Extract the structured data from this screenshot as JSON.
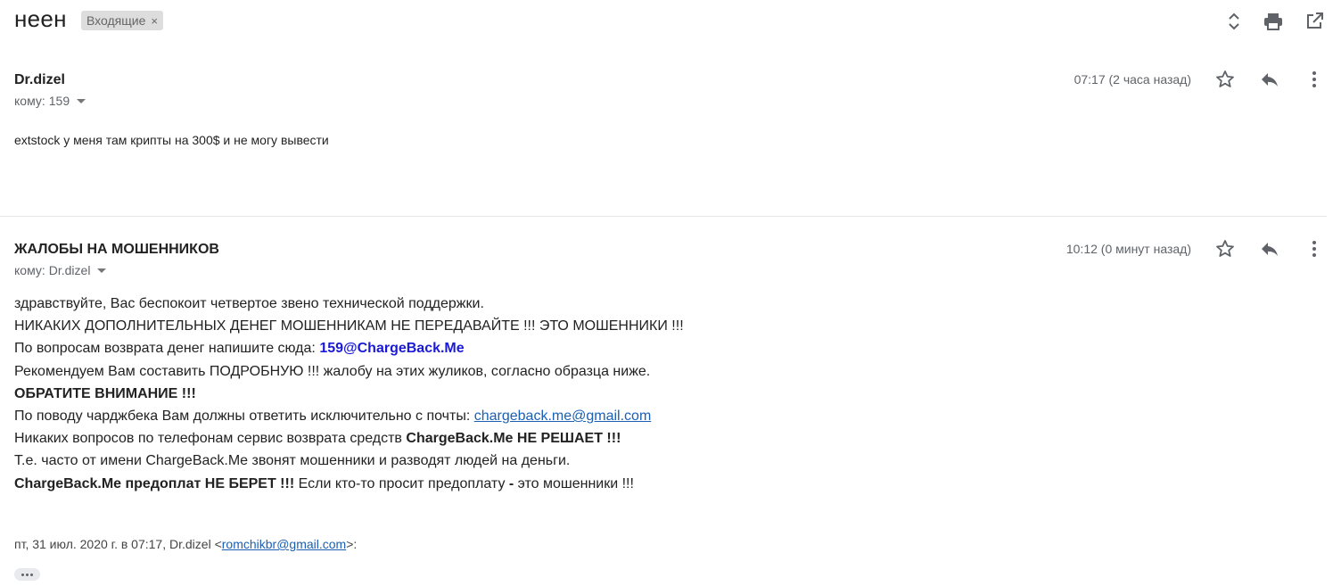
{
  "header": {
    "subject": "неен",
    "label": "Входящие",
    "label_remove": "×",
    "icons": [
      "expand-collapse-icon",
      "print-icon",
      "open-in-new-window-icon"
    ]
  },
  "messages": [
    {
      "sender": "Dr.dizel",
      "recipient_prefix": "кому:",
      "recipient": "159",
      "time": "07:17 (2 часа назад)",
      "body": "extstock у меня там крипты на 300$ и не могу вывести"
    },
    {
      "sender": "ЖАЛОБЫ НА МОШЕННИКОВ",
      "recipient_prefix": "кому:",
      "recipient": "Dr.dizel",
      "time": "10:12 (0 минут назад)",
      "body": {
        "l1": "здравствуйте, Вас беспокоит четвертое звено технической поддержки.",
        "l2": "НИКАКИХ ДОПОЛНИТЕЛЬНЫХ ДЕНЕГ МОШЕННИКАМ НЕ ПЕРЕДАВАЙТЕ !!! ЭТО МОШЕННИКИ !!!",
        "l3_text": "По вопросам возврата денег напишите сюда:",
        "l3_email": "159@ChargeBack.Me",
        "l4": "Рекомендуем Вам составить ПОДРОБНУЮ !!! жалобу на этих жуликов, согласно образца ниже.",
        "l5": "ОБРАТИТЕ ВНИМАНИЕ !!!",
        "l6_text": "По поводу чарджбека Вам должны ответить исключительно с почты:",
        "l6_link": "chargeback.me@gmail.com",
        "l7_text": "Никаких вопросов по телефонам сервис возврата средств",
        "l7_bold": "ChargeBack.Me НЕ РЕШАЕТ !!!",
        "l8": "Т.е. часто от имени ChargeBack.Me звонят мошенники и разводят людей на деньги.",
        "l9_bold": "ChargeBack.Me предоплат НЕ БЕРЕТ !!!",
        "l9_text": "Если кто-то просит предоплату",
        "l9_dash": "-",
        "l9_tail": "это мошенники !!!"
      },
      "quote": {
        "prefix": "пт, 31 июл. 2020 г. в 07:17, Dr.dizel <",
        "email": "romchikbr@gmail.com",
        "suffix": ">:"
      }
    }
  ],
  "message_icons": [
    "star-icon",
    "reply-icon",
    "more-vert-icon"
  ]
}
